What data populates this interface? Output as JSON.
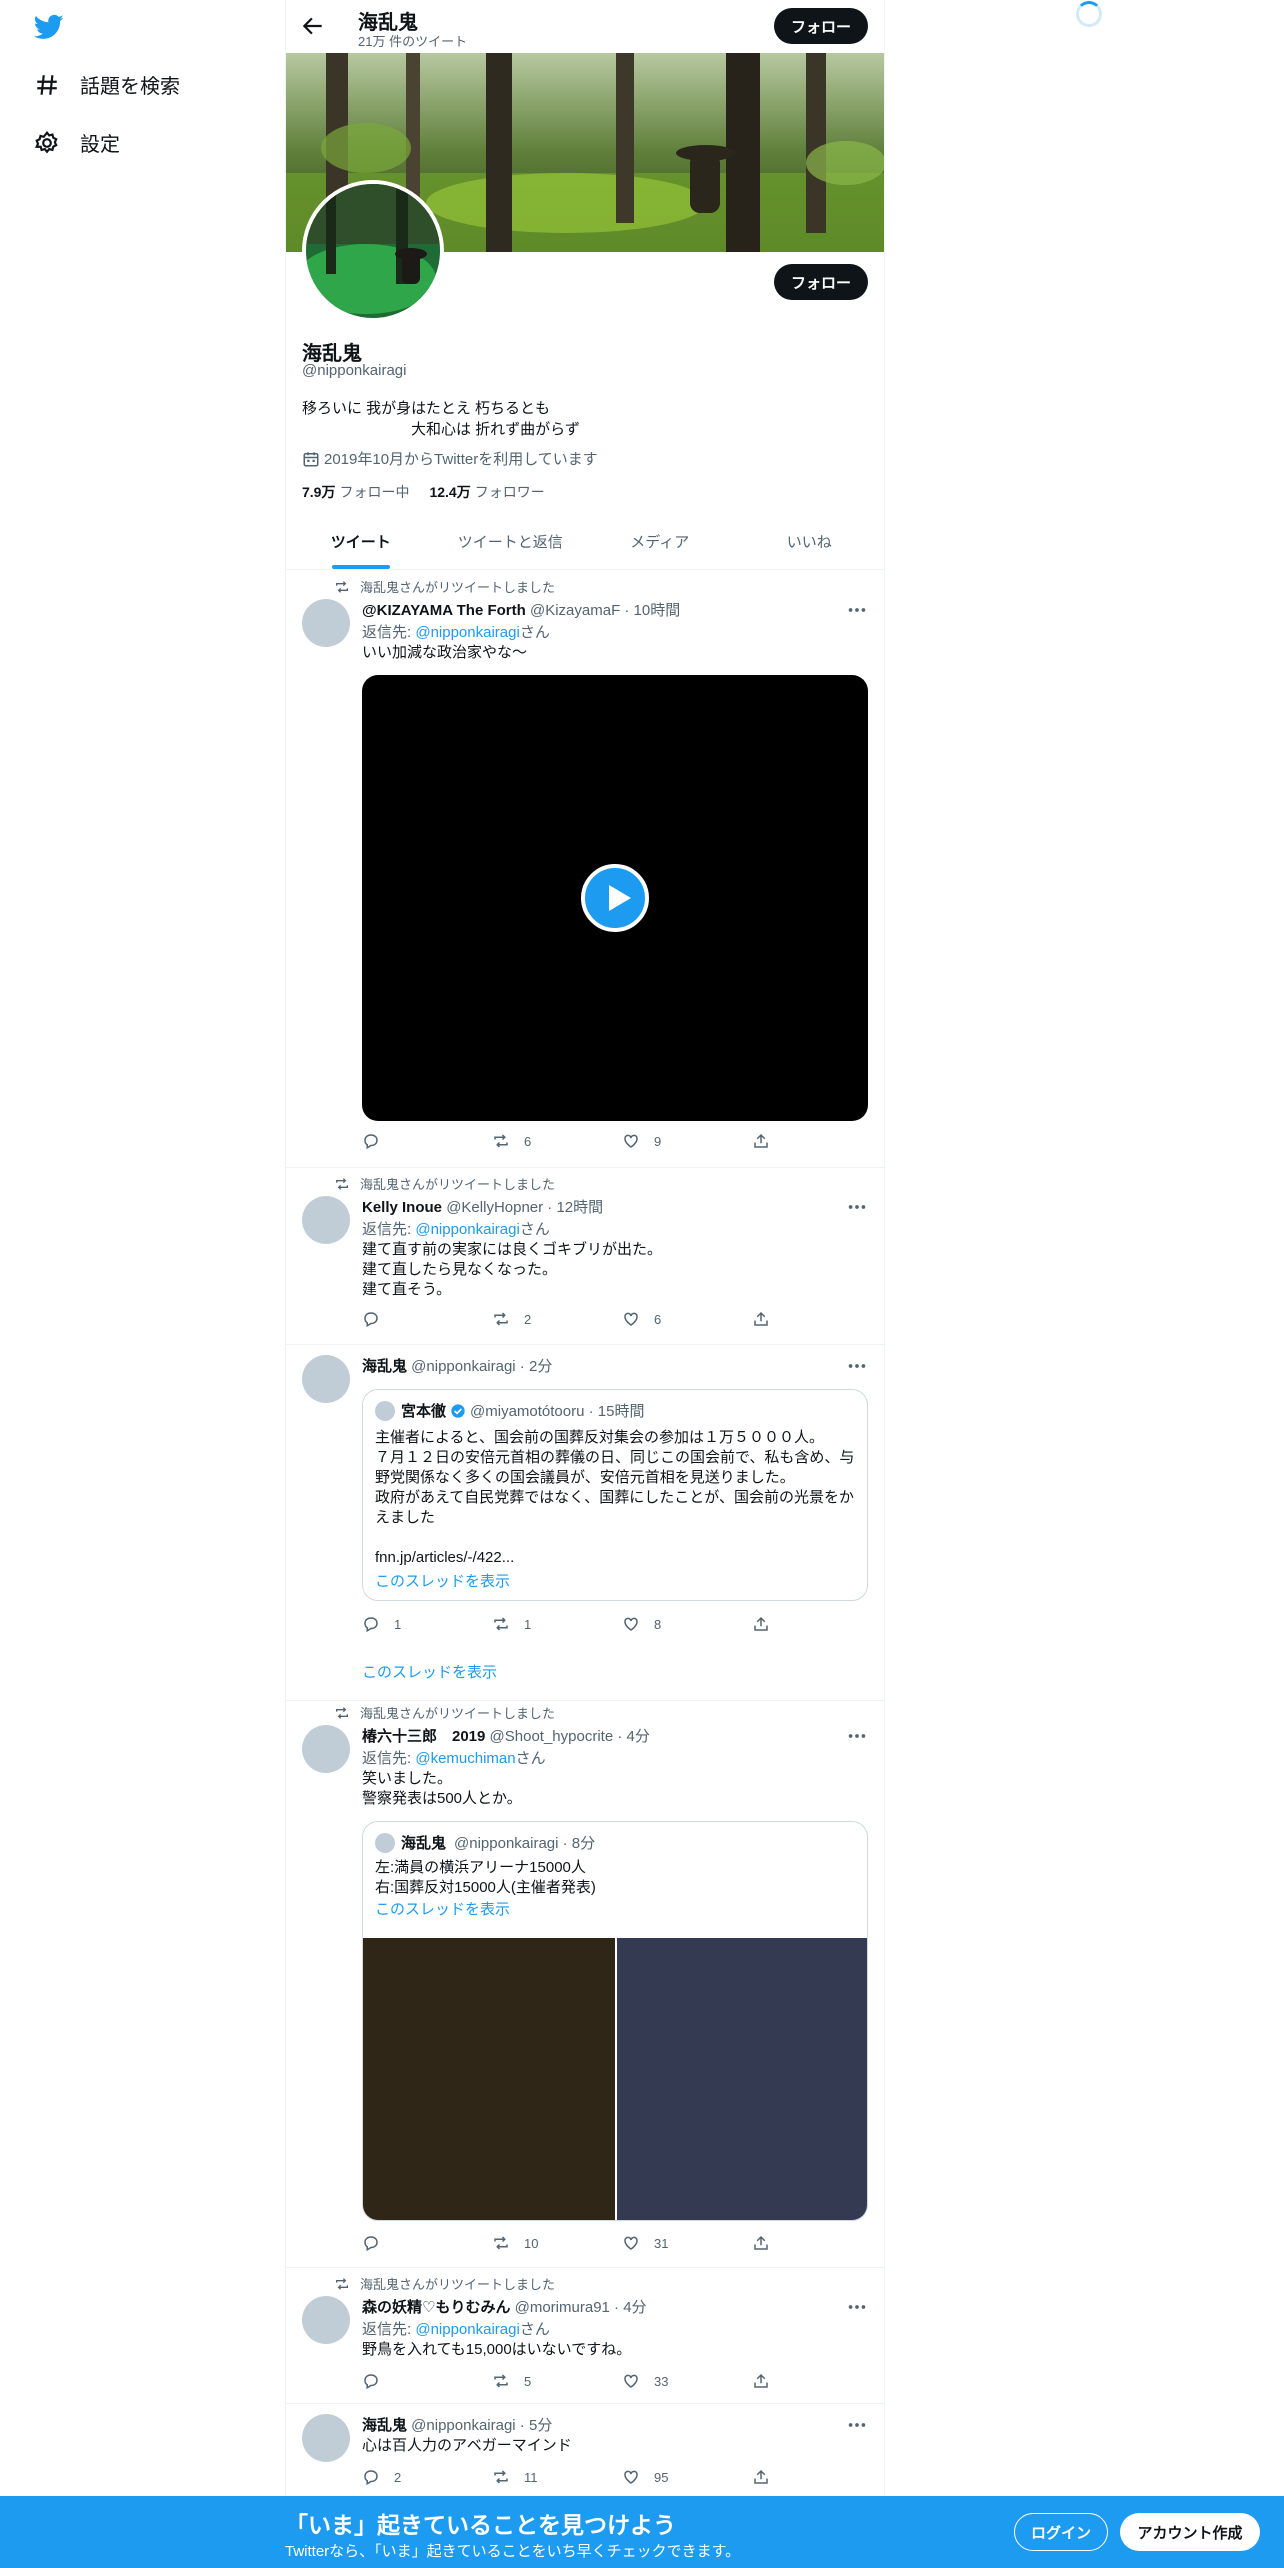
{
  "nav": {
    "explore_label": "話題を検索",
    "settings_label": "設定"
  },
  "header": {
    "name": "海乱鬼",
    "tweet_count": "21万 件のツイート",
    "follow_label": "フォロー"
  },
  "profile": {
    "name": "海乱鬼",
    "handle": "@nipponkairagi",
    "bio_line1": "移ろいに 我が身はたとえ 朽ちるとも",
    "bio_line2": "大和心は 折れず曲がらず",
    "joined": "2019年10月からTwitterを利用しています",
    "following_count": "7.9万",
    "following_label": "フォロー中",
    "followers_count": "12.4万",
    "followers_label": "フォロワー",
    "follow_label": "フォロー"
  },
  "tabs": [
    "ツイート",
    "ツイートと返信",
    "メディア",
    "いいね"
  ],
  "tweets": [
    {
      "retweet_line": "海乱鬼さんがリツイートしました",
      "name": "@KIZAYAMA The Forth",
      "meta": " @KizayamaF · 10時間",
      "reply_prefix": "返信先: ",
      "reply_handle": "@nipponkairagi",
      "reply_suffix": "さん",
      "text": "いい加減な政治家やな～",
      "reply_count": "",
      "retweet_count": "6",
      "like_count": "9"
    },
    {
      "retweet_line": "海乱鬼さんがリツイートしました",
      "name": "Kelly Inoue",
      "meta": " @KellyHopner · 12時間",
      "reply_prefix": "返信先: ",
      "reply_handle": "@nipponkairagi",
      "reply_suffix": "さん",
      "text_lines": [
        "建て直す前の実家には良くゴキブリが出た。",
        "建て直したら見なくなった。",
        "建て直そう。"
      ],
      "reply_count": "",
      "retweet_count": "2",
      "like_count": "6"
    },
    {
      "name": "海乱鬼",
      "meta": " @nipponkairagi · 2分",
      "quote": {
        "name": "宮本徹",
        "meta": "@miyamotótooru · 15時間",
        "text_lines": [
          "主催者によると、国会前の国葬反対集会の参加は１万５０００人。",
          "７月１２日の安倍元首相の葬儀の日、同じこの国会前で、私も含め、与",
          "野党関係なく多くの国会議員が、安倍元首相を見送りました。",
          "政府があえて自民党葬ではなく、国葬にしたことが、国会前の光景をか",
          "えました"
        ],
        "link": "fnn.jp/articles/-/422...",
        "show_thread": "このスレッドを表示"
      },
      "reply_count": "1",
      "retweet_count": "1",
      "like_count": "8",
      "show_thread": "このスレッドを表示"
    },
    {
      "retweet_line": "海乱鬼さんがリツイートしました",
      "name": "椿六十三郎　2019",
      "meta": " @Shoot_hypocrite · 4分",
      "reply_prefix": "返信先: ",
      "reply_handle": "@kemuchiman",
      "reply_suffix": "さん",
      "text_lines": [
        "笑いました。",
        "警察発表は500人とか。"
      ],
      "quote": {
        "name": "海乱鬼",
        "meta": "@nipponkairagi · 8分",
        "text_lines": [
          "左:満員の横浜アリーナ15000人",
          "右:国葬反対15000人(主催者発表)"
        ],
        "show_thread": "このスレッドを表示"
      },
      "reply_count": "",
      "retweet_count": "10",
      "like_count": "31"
    },
    {
      "retweet_line": "海乱鬼さんがリツイートしました",
      "name": "森の妖精♡もりむみん",
      "meta": " @morimura91 · 4分",
      "reply_prefix": "返信先: ",
      "reply_handle": "@nipponkairagi",
      "reply_suffix": "さん",
      "text": "野鳥を入れても15,000はいないですね。",
      "reply_count": "",
      "retweet_count": "5",
      "like_count": "33"
    },
    {
      "name": "海乱鬼",
      "meta": " @nipponkairagi · 5分",
      "text": "心は百人力のアベガーマインド",
      "reply_count": "2",
      "retweet_count": "11",
      "like_count": "95"
    }
  ],
  "bottom_bar": {
    "title": "「いま」起きていることを見つけよう",
    "subtitle": "Twitterなら、「いま」起きていることをいち早くチェックできます。",
    "login_label": "ログイン",
    "signup_label": "アカウント作成"
  },
  "colors": {
    "accent": "#1d9bf0",
    "text": "#0f1419",
    "secondary_text": "#536471"
  }
}
